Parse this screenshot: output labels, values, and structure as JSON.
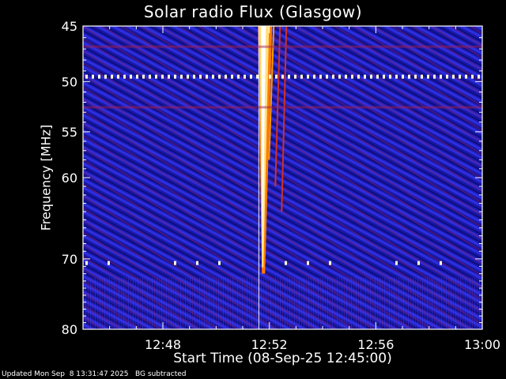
{
  "chart_data": {
    "type": "heatmap",
    "title": "Solar radio Flux (Glasgow)",
    "xlabel": "Start Time (08-Sep-25 12:45:00)",
    "ylabel": "Frequency [MHz]",
    "x_ticks": [
      "12:48",
      "12:52",
      "12:56",
      "13:00"
    ],
    "x_tick_minutes": [
      3,
      7,
      11,
      15
    ],
    "y_ticks": [
      45,
      50,
      55,
      60,
      70,
      80
    ],
    "xlim_minutes": [
      0,
      15
    ],
    "ylim_mhz": [
      45,
      80
    ],
    "y_scale": "log",
    "colormap": [
      "#000010",
      "#10109a",
      "#2a2ad0",
      "#8a1a60",
      "#e0301a",
      "#ff9a00",
      "#ffffc0"
    ],
    "features": [
      {
        "type": "burst",
        "label": "",
        "start_time": "12:51:40",
        "peak_time": "12:51:45",
        "freq_range_mhz": [
          45,
          72
        ]
      },
      {
        "type": "interference_line",
        "freq_mhz": 49.5
      },
      {
        "type": "interference_line",
        "freq_mhz": 70.5
      },
      {
        "type": "interference_line",
        "freq_mhz": 46.8
      },
      {
        "type": "interference_line",
        "freq_mhz": 52.5
      }
    ]
  },
  "footer_text": "Updated Mon Sep  8 13:31:47 2025   BG subtracted"
}
